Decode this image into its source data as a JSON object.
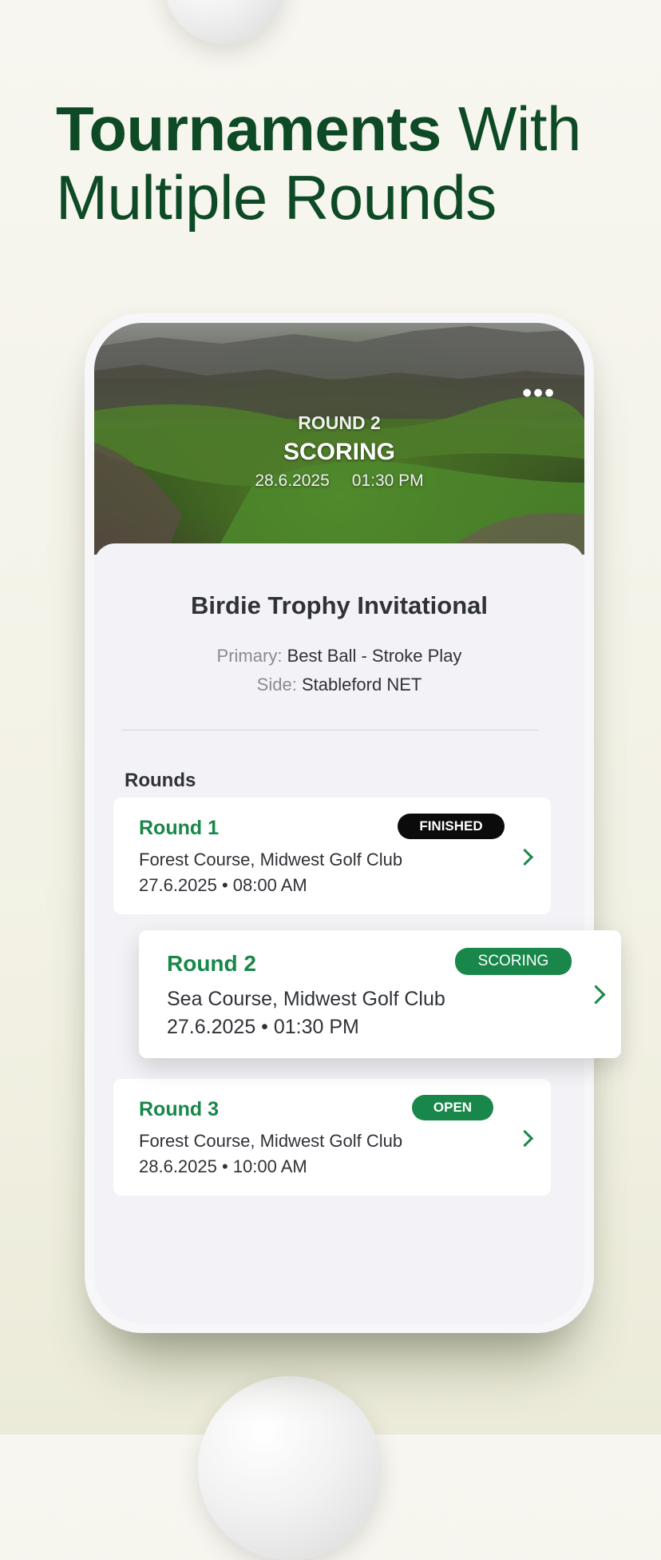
{
  "headline": {
    "bold": "Tournaments",
    "rest1": " With",
    "rest2": "Multiple Rounds"
  },
  "hero": {
    "round": "ROUND 2",
    "status": "SCORING",
    "date": "28.6.2025",
    "time": "01:30 PM",
    "more_icon": "•••"
  },
  "tournament": {
    "title": "Birdie Trophy Invitational",
    "primary_label": "Primary:",
    "primary_value": "Best Ball - Stroke Play",
    "side_label": "Side:",
    "side_value": "Stableford NET"
  },
  "rounds_label": "Rounds",
  "rounds": [
    {
      "name": "Round 1",
      "status": "FINISHED",
      "course": "Forest Course, Midwest Golf Club",
      "datetime": "27.6.2025 • 08:00 AM"
    },
    {
      "name": "Round 2",
      "status": "SCORING",
      "course": "Sea Course, Midwest Golf Club",
      "datetime": "27.6.2025 • 01:30 PM"
    },
    {
      "name": "Round 3",
      "status": "OPEN",
      "course": "Forest Course, Midwest Golf Club",
      "datetime": "28.6.2025 • 10:00 AM"
    }
  ],
  "colors": {
    "brand_green": "#188749",
    "headline_green": "#0d4a25",
    "finished_badge": "#0b0b0b"
  },
  "icons": {
    "more": "more-dots-icon",
    "chevron": "chevron-right-icon"
  }
}
